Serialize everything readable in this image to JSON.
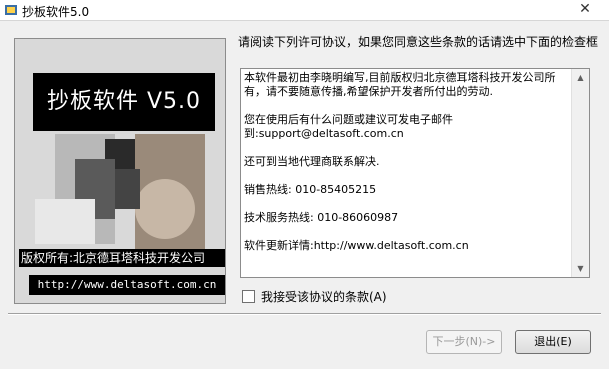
{
  "window": {
    "title": "抄板软件5.0",
    "close_symbol": "✕"
  },
  "banner": {
    "title": "抄板软件 V5.0",
    "copyright": "版权所有:北京德耳塔科技开发公司",
    "url": "http://www.deltasoft.com.cn"
  },
  "instruction": "请阅读下列许可协议，如果您同意这些条款的话请选中下面的检查框",
  "license": {
    "lines": [
      "本软件最初由李晓明编写,目前版权归北京德耳塔科技开发公司所有，请不要随意传播,希望保护开发者所付出的劳动.",
      "",
      "您在使用后有什么问题或建议可发电子邮件到:support@deltasoft.com.cn",
      "",
      "还可到当地代理商联系解决.",
      "",
      "销售热线:  010-85405215",
      "",
      "技术服务热线: 010-86060987",
      "",
      "软件更新详情:http://www.deltasoft.com.cn"
    ]
  },
  "agree_label": "我接受该协议的条款(A)",
  "buttons": {
    "next": "下一步(N)->",
    "exit": "退出(E)"
  },
  "colors": {
    "banner_bg": "#000000",
    "window_bg": "#f0f0f0"
  }
}
